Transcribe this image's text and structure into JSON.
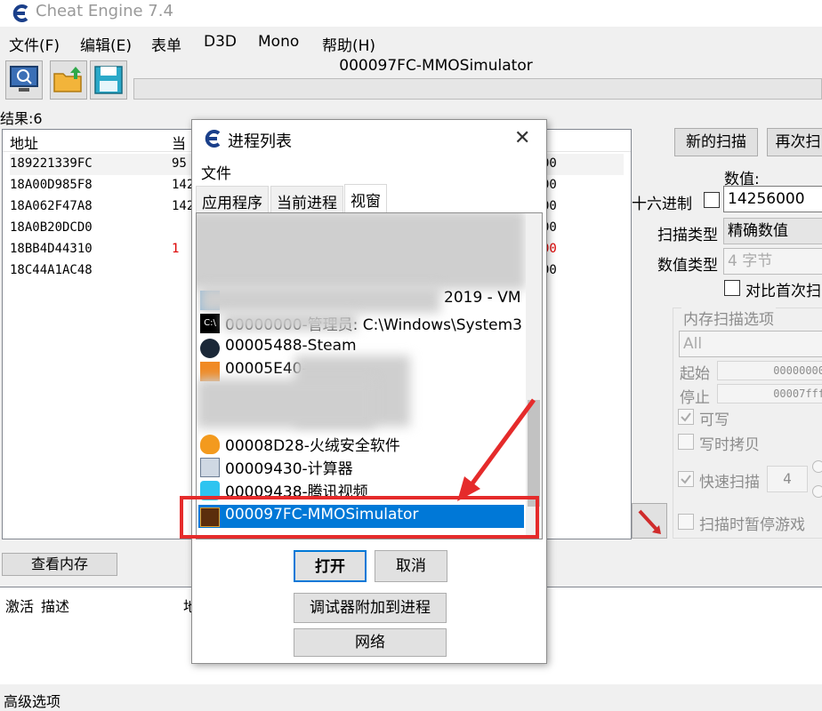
{
  "window": {
    "title": "Cheat Engine 7.4"
  },
  "menu": [
    "文件(F)",
    "编辑(E)",
    "表单",
    "D3D",
    "Mono",
    "帮助(H)"
  ],
  "toolbar": {
    "process_title": "000097FC-MMOSimulator"
  },
  "results": {
    "label": "结果:6",
    "headers": {
      "address": "地址",
      "value": "当"
    },
    "rows": [
      {
        "address": "189221339FC",
        "value": "95",
        "previous": "00"
      },
      {
        "address": "18A00D985F8",
        "value": "142",
        "previous": "00"
      },
      {
        "address": "18A062F47A8",
        "value": "142",
        "previous": "00"
      },
      {
        "address": "18A0B20DCD0",
        "value": "",
        "previous": "00"
      },
      {
        "address": "18BB4D44310",
        "value": "1",
        "previous": "00"
      },
      {
        "address": "18C44A1AC48",
        "value": "",
        "previous": "00"
      }
    ],
    "view_memory": "查看内存"
  },
  "address_list": {
    "headers": [
      "激活",
      "描述",
      "地"
    ]
  },
  "advanced_options": "高级选项",
  "scan": {
    "new_scan": "新的扫描",
    "next_scan": "再次扫",
    "value_label": "数值:",
    "hex_label": "十六进制",
    "value": "14256000",
    "scan_type_label": "扫描类型",
    "scan_type": "精确数值",
    "value_type_label": "数值类型",
    "value_type": "4 字节",
    "compare_first": "对比首次扫",
    "mem_options_label": "内存扫描选项",
    "mem_region": "All",
    "start_label": "起始",
    "start_value": "00000000",
    "stop_label": "停止",
    "stop_value": "00007fff",
    "writable": "可写",
    "copy_on_write": "写时拷贝",
    "fast_scan": "快速扫描",
    "fast_scan_value": "4",
    "pause_game": "扫描时暂停游戏"
  },
  "dialog": {
    "title": "进程列表",
    "close": "✕",
    "menu_file": "文件",
    "tabs": [
      "应用程序",
      "当前进程",
      "视窗"
    ],
    "processes": [
      {
        "text": "2019 - VM",
        "icon": "app-icon"
      },
      {
        "text": "00000000-管理员: C:\\Windows\\System3",
        "icon": "cmd-icon"
      },
      {
        "text": "00005488-Steam",
        "icon": "steam-icon"
      },
      {
        "text": "00005E40-",
        "icon": "app-icon"
      },
      {
        "text": "00008D28-火绒安全软件",
        "icon": "huorong-icon"
      },
      {
        "text": "00009430-计算器",
        "icon": "calculator-icon"
      },
      {
        "text": "00009438-腾讯视频",
        "icon": "tencent-video-icon"
      },
      {
        "text": "000097FC-MMOSimulator",
        "icon": "game-icon"
      }
    ],
    "open": "打开",
    "cancel": "取消",
    "attach_debugger": "调试器附加到进程",
    "network": "网络"
  },
  "colors": {
    "selection": "#0078d7",
    "annotation": "#e52b2b"
  }
}
